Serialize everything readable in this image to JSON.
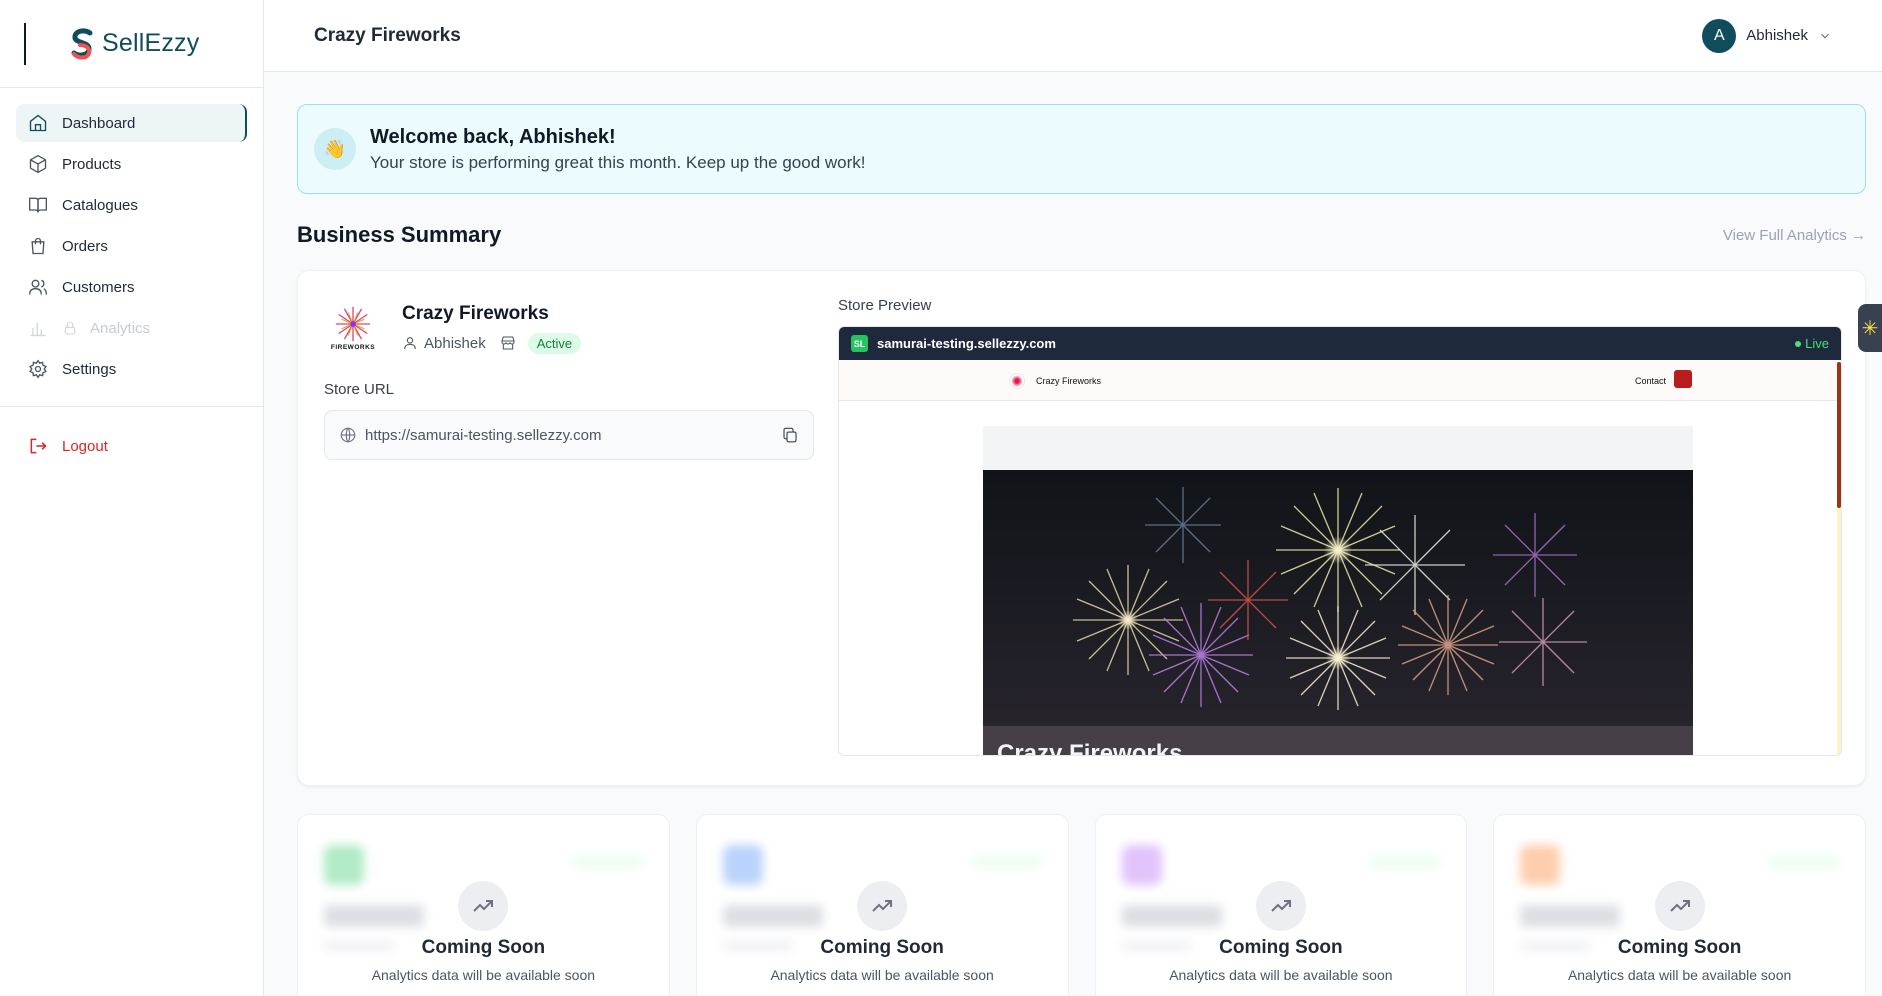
{
  "app": {
    "name": "SellEzzy"
  },
  "sidebar": {
    "items": [
      {
        "label": "Dashboard",
        "icon": "home-icon"
      },
      {
        "label": "Products",
        "icon": "box-icon"
      },
      {
        "label": "Catalogues",
        "icon": "book-icon"
      },
      {
        "label": "Orders",
        "icon": "shopping-bag-icon"
      },
      {
        "label": "Customers",
        "icon": "users-icon"
      },
      {
        "label": "Analytics",
        "icon": "bar-chart-icon"
      },
      {
        "label": "Settings",
        "icon": "gear-icon"
      }
    ],
    "logout": "Logout"
  },
  "header": {
    "title": "Crazy Fireworks",
    "user": {
      "initial": "A",
      "name": "Abhishek"
    }
  },
  "welcome": {
    "title": "Welcome back, Abhishek!",
    "message": "Your store is performing great this month. Keep up the good work!"
  },
  "summary": {
    "heading": "Business Summary",
    "analytics_link": "View Full Analytics →",
    "store": {
      "name": "Crazy Fireworks",
      "logo_text": "FIREWORKS",
      "owner": "Abhishek",
      "status": "Active",
      "url_label": "Store URL",
      "url": "https://samurai-testing.sellezzy.com"
    },
    "preview": {
      "label": "Store Preview",
      "badge": "SL",
      "domain": "samurai-testing.sellezzy.com",
      "live": "Live",
      "site_name": "Crazy Fireworks",
      "contact": "Contact",
      "hero_title": "Crazy Fireworks"
    }
  },
  "stats": [
    {
      "title": "Coming Soon",
      "text": "Analytics data will be available soon",
      "accent": "#22c55e"
    },
    {
      "title": "Coming Soon",
      "text": "Analytics data will be available soon",
      "accent": "#3b82f6"
    },
    {
      "title": "Coming Soon",
      "text": "Analytics data will be available soon",
      "accent": "#a855f7"
    },
    {
      "title": "Coming Soon",
      "text": "Analytics data will be available soon",
      "accent": "#f97316"
    }
  ],
  "colors": {
    "brand": "#0f4c5c",
    "danger": "#dc2626",
    "success": "#22c55e"
  }
}
